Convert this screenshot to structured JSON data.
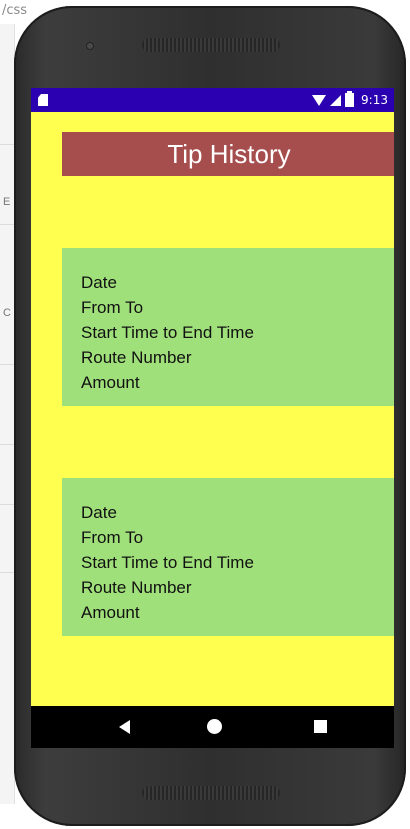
{
  "browser": {
    "url_fragment": "/css",
    "side_letters": [
      "E",
      "C"
    ]
  },
  "status_bar": {
    "time": "9:13",
    "bar_color": "#2a00b0"
  },
  "app": {
    "title": "Tip History",
    "background": "#ffff4f",
    "title_color": "#a64d4d",
    "card_color": "#a0e07a"
  },
  "cards": [
    {
      "lines": [
        "Date",
        "From To",
        "Start Time to End Time",
        "Route Number",
        "Amount"
      ]
    },
    {
      "lines": [
        "Date",
        "From To",
        "Start Time to End Time",
        "Route Number",
        "Amount"
      ]
    }
  ],
  "nav": {
    "back_icon": "triangle-left",
    "home_icon": "circle",
    "recents_icon": "square"
  }
}
